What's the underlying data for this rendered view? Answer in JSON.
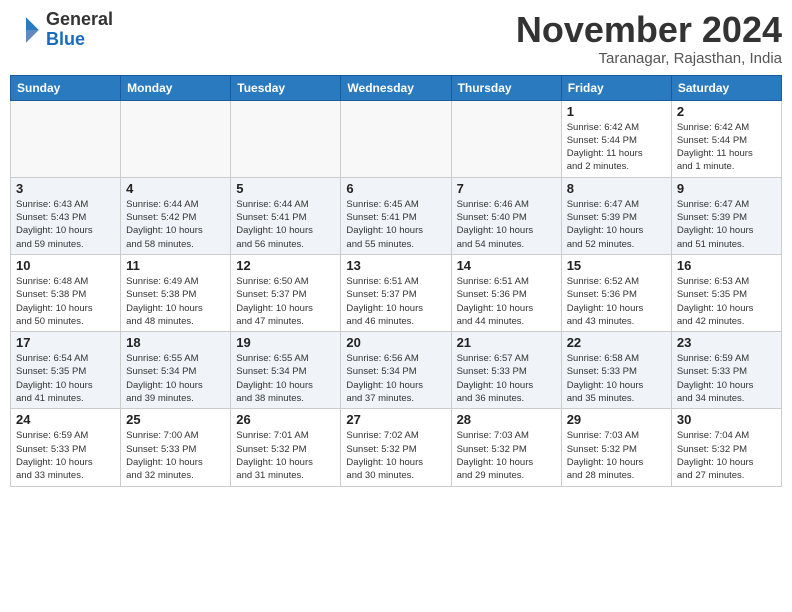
{
  "header": {
    "logo_line1": "General",
    "logo_line2": "Blue",
    "month_title": "November 2024",
    "subtitle": "Taranagar, Rajasthan, India"
  },
  "weekdays": [
    "Sunday",
    "Monday",
    "Tuesday",
    "Wednesday",
    "Thursday",
    "Friday",
    "Saturday"
  ],
  "weeks": [
    [
      {
        "day": "",
        "info": ""
      },
      {
        "day": "",
        "info": ""
      },
      {
        "day": "",
        "info": ""
      },
      {
        "day": "",
        "info": ""
      },
      {
        "day": "",
        "info": ""
      },
      {
        "day": "1",
        "info": "Sunrise: 6:42 AM\nSunset: 5:44 PM\nDaylight: 11 hours\nand 2 minutes."
      },
      {
        "day": "2",
        "info": "Sunrise: 6:42 AM\nSunset: 5:44 PM\nDaylight: 11 hours\nand 1 minute."
      }
    ],
    [
      {
        "day": "3",
        "info": "Sunrise: 6:43 AM\nSunset: 5:43 PM\nDaylight: 10 hours\nand 59 minutes."
      },
      {
        "day": "4",
        "info": "Sunrise: 6:44 AM\nSunset: 5:42 PM\nDaylight: 10 hours\nand 58 minutes."
      },
      {
        "day": "5",
        "info": "Sunrise: 6:44 AM\nSunset: 5:41 PM\nDaylight: 10 hours\nand 56 minutes."
      },
      {
        "day": "6",
        "info": "Sunrise: 6:45 AM\nSunset: 5:41 PM\nDaylight: 10 hours\nand 55 minutes."
      },
      {
        "day": "7",
        "info": "Sunrise: 6:46 AM\nSunset: 5:40 PM\nDaylight: 10 hours\nand 54 minutes."
      },
      {
        "day": "8",
        "info": "Sunrise: 6:47 AM\nSunset: 5:39 PM\nDaylight: 10 hours\nand 52 minutes."
      },
      {
        "day": "9",
        "info": "Sunrise: 6:47 AM\nSunset: 5:39 PM\nDaylight: 10 hours\nand 51 minutes."
      }
    ],
    [
      {
        "day": "10",
        "info": "Sunrise: 6:48 AM\nSunset: 5:38 PM\nDaylight: 10 hours\nand 50 minutes."
      },
      {
        "day": "11",
        "info": "Sunrise: 6:49 AM\nSunset: 5:38 PM\nDaylight: 10 hours\nand 48 minutes."
      },
      {
        "day": "12",
        "info": "Sunrise: 6:50 AM\nSunset: 5:37 PM\nDaylight: 10 hours\nand 47 minutes."
      },
      {
        "day": "13",
        "info": "Sunrise: 6:51 AM\nSunset: 5:37 PM\nDaylight: 10 hours\nand 46 minutes."
      },
      {
        "day": "14",
        "info": "Sunrise: 6:51 AM\nSunset: 5:36 PM\nDaylight: 10 hours\nand 44 minutes."
      },
      {
        "day": "15",
        "info": "Sunrise: 6:52 AM\nSunset: 5:36 PM\nDaylight: 10 hours\nand 43 minutes."
      },
      {
        "day": "16",
        "info": "Sunrise: 6:53 AM\nSunset: 5:35 PM\nDaylight: 10 hours\nand 42 minutes."
      }
    ],
    [
      {
        "day": "17",
        "info": "Sunrise: 6:54 AM\nSunset: 5:35 PM\nDaylight: 10 hours\nand 41 minutes."
      },
      {
        "day": "18",
        "info": "Sunrise: 6:55 AM\nSunset: 5:34 PM\nDaylight: 10 hours\nand 39 minutes."
      },
      {
        "day": "19",
        "info": "Sunrise: 6:55 AM\nSunset: 5:34 PM\nDaylight: 10 hours\nand 38 minutes."
      },
      {
        "day": "20",
        "info": "Sunrise: 6:56 AM\nSunset: 5:34 PM\nDaylight: 10 hours\nand 37 minutes."
      },
      {
        "day": "21",
        "info": "Sunrise: 6:57 AM\nSunset: 5:33 PM\nDaylight: 10 hours\nand 36 minutes."
      },
      {
        "day": "22",
        "info": "Sunrise: 6:58 AM\nSunset: 5:33 PM\nDaylight: 10 hours\nand 35 minutes."
      },
      {
        "day": "23",
        "info": "Sunrise: 6:59 AM\nSunset: 5:33 PM\nDaylight: 10 hours\nand 34 minutes."
      }
    ],
    [
      {
        "day": "24",
        "info": "Sunrise: 6:59 AM\nSunset: 5:33 PM\nDaylight: 10 hours\nand 33 minutes."
      },
      {
        "day": "25",
        "info": "Sunrise: 7:00 AM\nSunset: 5:33 PM\nDaylight: 10 hours\nand 32 minutes."
      },
      {
        "day": "26",
        "info": "Sunrise: 7:01 AM\nSunset: 5:32 PM\nDaylight: 10 hours\nand 31 minutes."
      },
      {
        "day": "27",
        "info": "Sunrise: 7:02 AM\nSunset: 5:32 PM\nDaylight: 10 hours\nand 30 minutes."
      },
      {
        "day": "28",
        "info": "Sunrise: 7:03 AM\nSunset: 5:32 PM\nDaylight: 10 hours\nand 29 minutes."
      },
      {
        "day": "29",
        "info": "Sunrise: 7:03 AM\nSunset: 5:32 PM\nDaylight: 10 hours\nand 28 minutes."
      },
      {
        "day": "30",
        "info": "Sunrise: 7:04 AM\nSunset: 5:32 PM\nDaylight: 10 hours\nand 27 minutes."
      }
    ]
  ]
}
